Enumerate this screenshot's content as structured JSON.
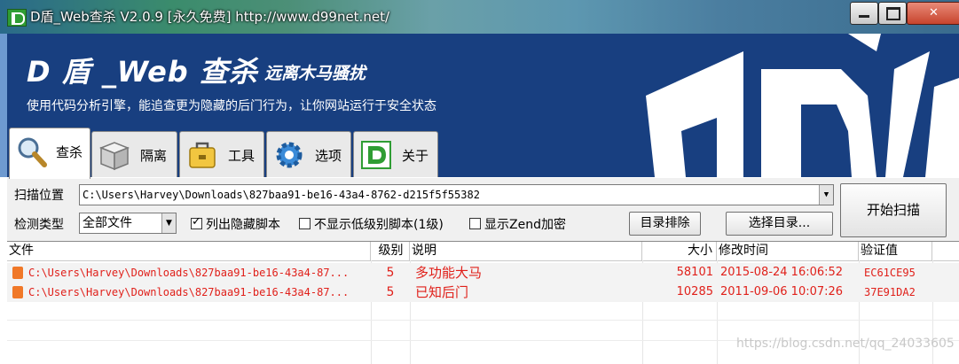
{
  "window": {
    "title": "D盾_Web查杀 V2.0.9 [永久免费] http://www.d99net.net/",
    "controls": {
      "minimize": "minimize",
      "maximize": "maximize",
      "close": "✕"
    }
  },
  "banner": {
    "title": "D 盾 _Web 查杀",
    "slogan": "远离木马骚扰",
    "subtitle": "使用代码分析引擎，能追查更为隐藏的后门行为，让你网站运行于安全状态",
    "colors": {
      "background": "#183f80",
      "logo": "#ffffff"
    }
  },
  "tabs": [
    {
      "label": "查杀",
      "icon": "magnifier-icon",
      "active": true
    },
    {
      "label": "隔离",
      "icon": "box-icon",
      "active": false
    },
    {
      "label": "工具",
      "icon": "toolbox-icon",
      "active": false
    },
    {
      "label": "选项",
      "icon": "gear-icon",
      "active": false
    },
    {
      "label": "关于",
      "icon": "d-logo-icon",
      "active": false
    }
  ],
  "scan": {
    "location_label": "扫描位置",
    "location_value": "C:\\Users\\Harvey\\Downloads\\827baa91-be16-43a4-8762-d215f5f55382",
    "type_label": "检测类型",
    "type_value": "全部文件",
    "option_hidden": "列出隐藏脚本",
    "option_lowlevel": "不显示低级别脚本(1级)",
    "option_zend": "显示Zend加密",
    "exclude_button": "目录排除",
    "select_dir_button": "选择目录...",
    "start_button": "开始扫描",
    "checks": {
      "hidden": true,
      "lowlevel": false,
      "zend": false
    }
  },
  "table": {
    "columns": [
      "文件",
      "级别",
      "说明",
      "大小",
      "修改时间",
      "验证值"
    ],
    "rows": [
      {
        "file": "C:\\Users\\Harvey\\Downloads\\827baa91-be16-43a4-87...",
        "level": "5",
        "desc": "多功能大马",
        "size": "58101",
        "mtime": "2015-08-24 16:06:52",
        "hash": "EC61CE95"
      },
      {
        "file": "C:\\Users\\Harvey\\Downloads\\827baa91-be16-43a4-87...",
        "level": "5",
        "desc": "已知后门",
        "size": "10285",
        "mtime": "2011-09-06 10:07:26",
        "hash": "37E91DA2"
      }
    ],
    "row_color": "#e0201a"
  },
  "watermark": "https://blog.csdn.net/qq_24033605"
}
